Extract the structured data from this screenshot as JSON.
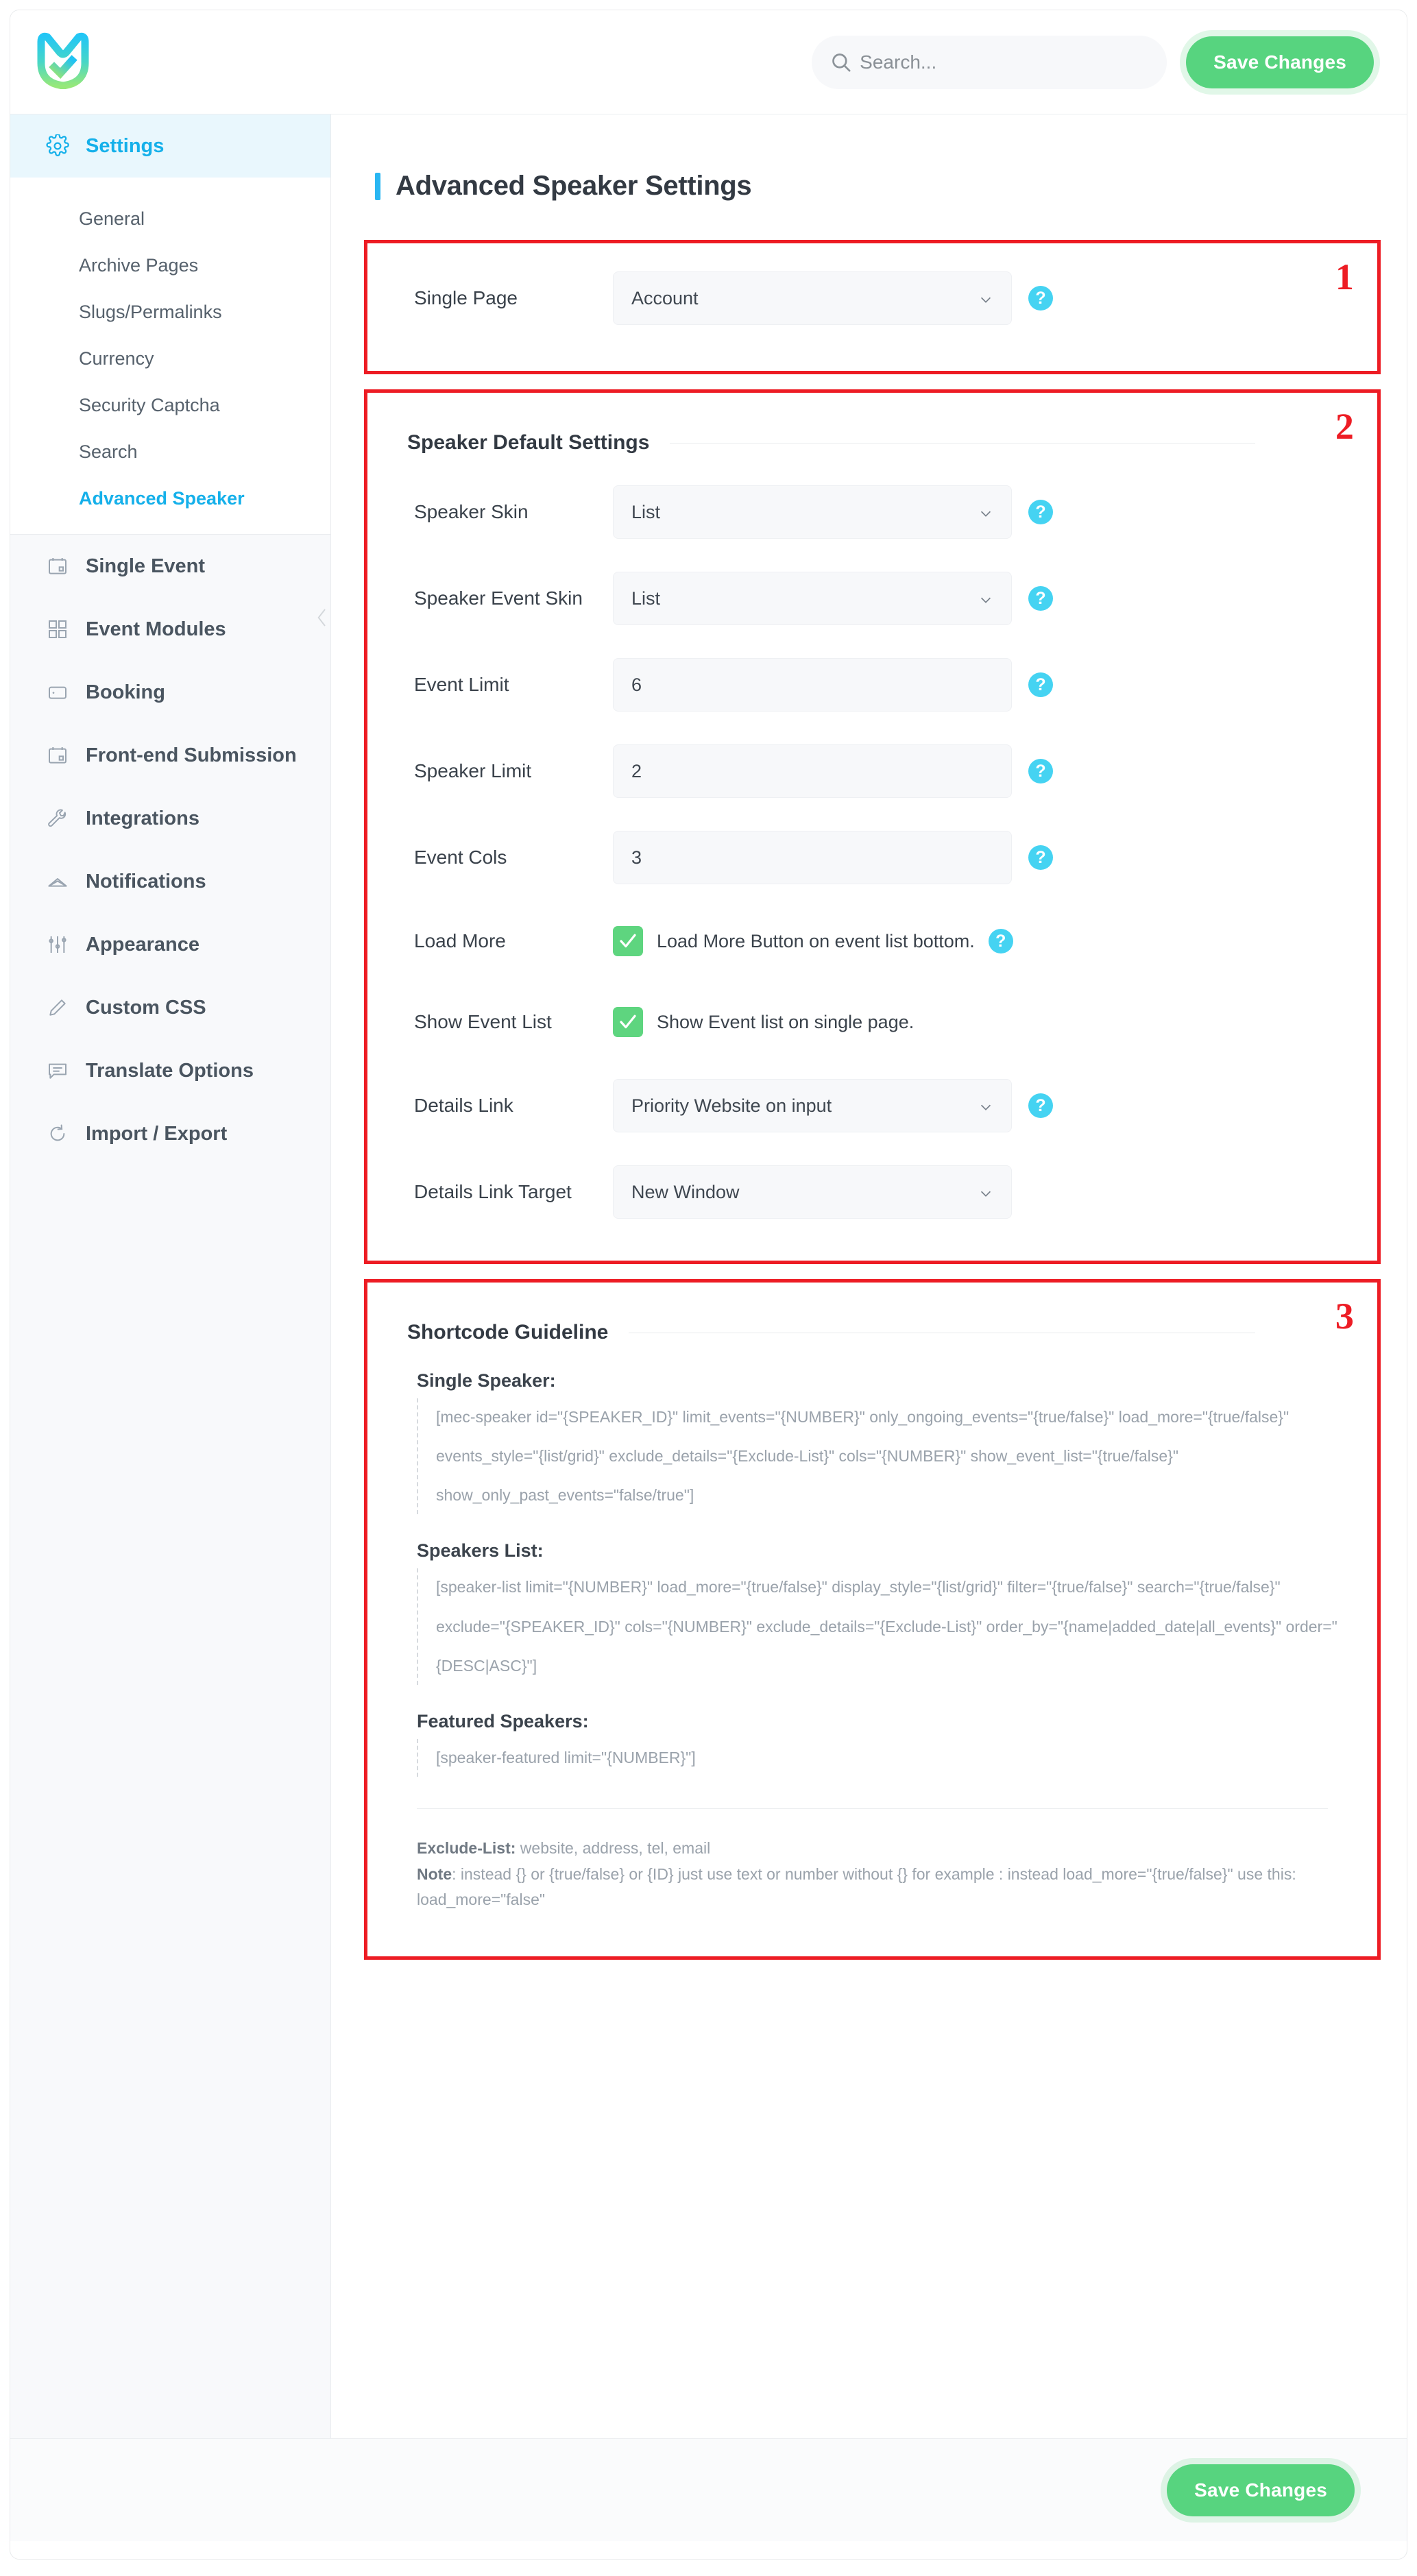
{
  "header": {
    "logo_name": "mec-logo",
    "search": {
      "placeholder": "Search...",
      "value": ""
    },
    "save_label": "Save Changes"
  },
  "sidebar": {
    "active_section": "Settings",
    "sections": [
      {
        "label": "Settings",
        "icon": "gear-icon",
        "active": true
      },
      {
        "label": "Single Event",
        "icon": "calendar-icon",
        "active": false
      },
      {
        "label": "Event Modules",
        "icon": "grid-icon",
        "active": false
      },
      {
        "label": "Booking",
        "icon": "wallet-icon",
        "active": false
      },
      {
        "label": "Front-end Submission",
        "icon": "calendar-icon",
        "active": false
      },
      {
        "label": "Integrations",
        "icon": "wrench-icon",
        "active": false
      },
      {
        "label": "Notifications",
        "icon": "envelope-icon",
        "active": false
      },
      {
        "label": "Appearance",
        "icon": "sliders-icon",
        "active": false
      },
      {
        "label": "Custom CSS",
        "icon": "pencil-icon",
        "active": false
      },
      {
        "label": "Translate Options",
        "icon": "comment-icon",
        "active": false
      },
      {
        "label": "Import / Export",
        "icon": "refresh-icon",
        "active": false
      }
    ],
    "sub_items": [
      {
        "label": "General",
        "active": false
      },
      {
        "label": "Archive Pages",
        "active": false
      },
      {
        "label": "Slugs/Permalinks",
        "active": false
      },
      {
        "label": "Currency",
        "active": false
      },
      {
        "label": "Security Captcha",
        "active": false
      },
      {
        "label": "Search",
        "active": false
      },
      {
        "label": "Advanced Speaker",
        "active": true
      }
    ]
  },
  "main": {
    "page_title": "Advanced Speaker Settings",
    "annotations": {
      "one": "1",
      "two": "2",
      "three": "3"
    },
    "section1": {
      "rows": [
        {
          "label": "Single Page",
          "type": "select",
          "value": "Account",
          "help": true
        }
      ]
    },
    "section2": {
      "heading": "Speaker Default Settings",
      "rows": [
        {
          "label": "Speaker Skin",
          "type": "select",
          "value": "List",
          "help": true
        },
        {
          "label": "Speaker Event Skin",
          "type": "select",
          "value": "List",
          "help": true
        },
        {
          "label": "Event Limit",
          "type": "text",
          "value": "6",
          "help": true
        },
        {
          "label": "Speaker Limit",
          "type": "text",
          "value": "2",
          "help": true
        },
        {
          "label": "Event Cols",
          "type": "text",
          "value": "3",
          "help": true
        },
        {
          "label": "Load More",
          "type": "checkbox",
          "checked": true,
          "check_label": "Load More Button on event list bottom.",
          "help": true
        },
        {
          "label": "Show Event List",
          "type": "checkbox",
          "checked": true,
          "check_label": "Show Event list on single page.",
          "help": false
        },
        {
          "label": "Details Link",
          "type": "select",
          "value": "Priority Website on input",
          "help": true
        },
        {
          "label": "Details Link Target",
          "type": "select",
          "value": "New Window",
          "help": false
        }
      ]
    },
    "section3": {
      "heading": "Shortcode Guideline",
      "groups": [
        {
          "label": "Single Speaker:",
          "lines": [
            "[mec-speaker id=\"{SPEAKER_ID}\" limit_events=\"{NUMBER}\" only_ongoing_events=\"{true/false}\" load_more=\"{true/false}\"",
            "events_style=\"{list/grid}\" exclude_details=\"{Exclude-List}\" cols=\"{NUMBER}\" show_event_list=\"{true/false}\"",
            "show_only_past_events=\"false/true\"]"
          ]
        },
        {
          "label": "Speakers List:",
          "lines": [
            "[speaker-list limit=\"{NUMBER}\" load_more=\"{true/false}\" display_style=\"{list/grid}\" filter=\"{true/false}\" search=\"{true/false}\"",
            "exclude=\"{SPEAKER_ID}\" cols=\"{NUMBER}\" exclude_details=\"{Exclude-List}\" order_by=\"{name|added_date|all_events}\" order=\"",
            "{DESC|ASC}\"]"
          ]
        },
        {
          "label": "Featured Speakers:",
          "lines": [
            "[speaker-featured limit=\"{NUMBER}\"]"
          ]
        }
      ],
      "note_exclude_key": "Exclude-List:",
      "note_exclude_value": " website, address, tel, email",
      "note_key": "Note",
      "note_value": ": instead {} or {true/false} or {ID} just use text or number without {} for example : instead load_more=\"{true/false}\" use this:",
      "note_value2": "load_more=\"false\""
    }
  },
  "footer": {
    "save_label": "Save Changes"
  },
  "colors": {
    "accent_blue": "#15b0ea",
    "green": "#57d47f",
    "help_cyan": "#45d3f2",
    "annotation_red": "#ed1c24",
    "title_bar": "#29b6f2"
  }
}
